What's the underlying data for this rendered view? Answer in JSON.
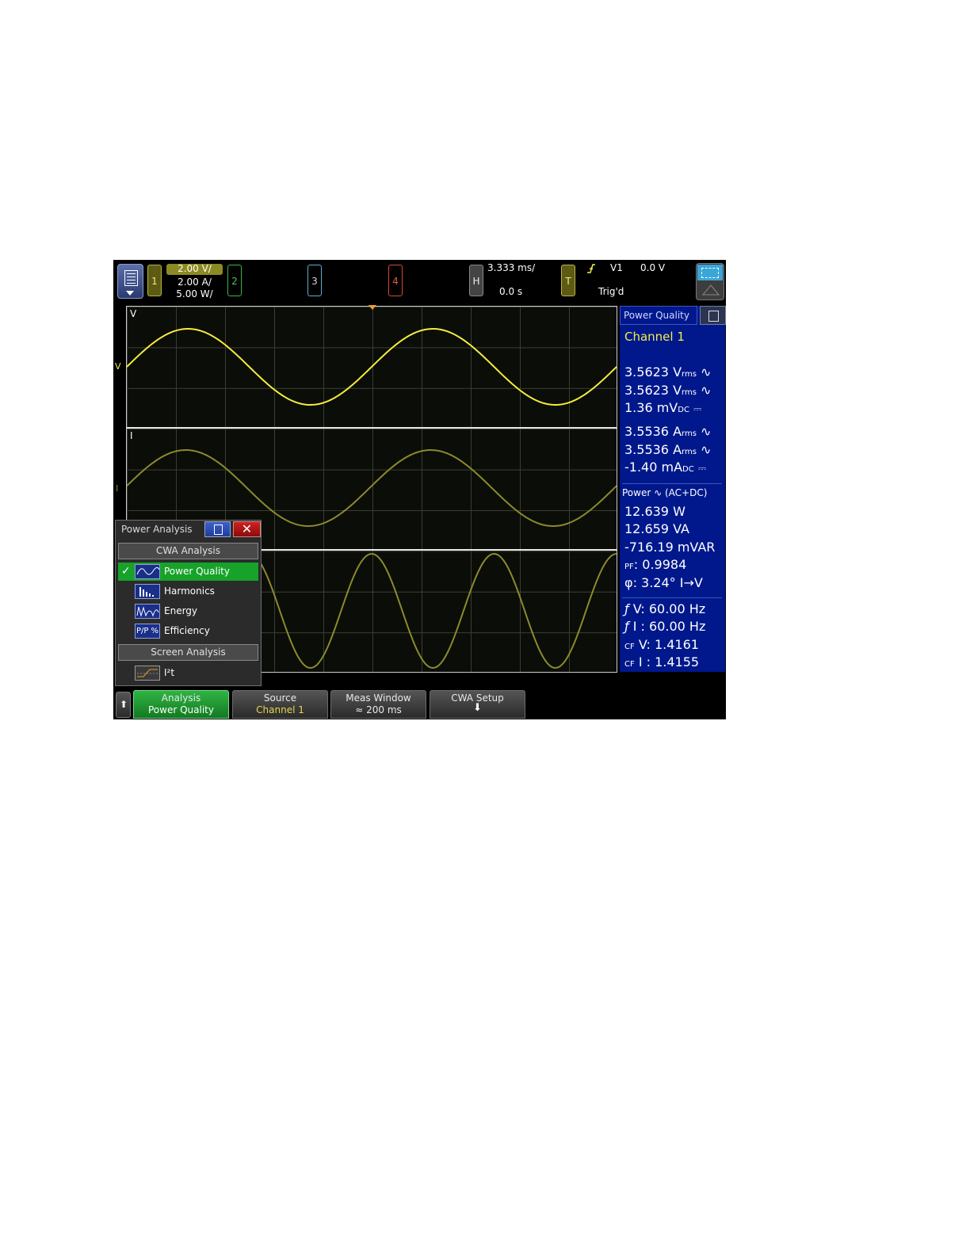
{
  "topbar": {
    "ch1_label": "1",
    "ch1_scales": [
      "2.00 V/",
      "2.00 A/",
      "5.00 W/"
    ],
    "ch2_label": "2",
    "ch3_label": "3",
    "ch4_label": "4",
    "horizontal_label": "H",
    "time_per_div": "3.333 ms/",
    "delay": "0.0 s",
    "trigger_label": "T",
    "trigger_source": "V1",
    "trigger_level": "0.0 V",
    "trigger_status": "Trig'd"
  },
  "graticule": {
    "label_v": "V",
    "label_i": "I",
    "marker_v": "V",
    "marker_i": "I"
  },
  "measurements": {
    "header": "Power Quality",
    "source": "Channel 1",
    "voltage": [
      {
        "value": "3.5623 V",
        "unit": "rms"
      },
      {
        "value": "3.5623 V",
        "unit": "rms"
      },
      {
        "value": "1.36 mV",
        "unit": "DC"
      }
    ],
    "current": [
      {
        "value": "3.5536 A",
        "unit": "rms"
      },
      {
        "value": "3.5536 A",
        "unit": "rms"
      },
      {
        "value": "-1.40 mA",
        "unit": "DC"
      }
    ],
    "power_header": "Power",
    "power_mode": "(AC+DC)",
    "power": [
      "12.639 W",
      "12.659 VA",
      "-716.19 mVAR"
    ],
    "pf_label": "PF",
    "pf_value": ": 0.9984",
    "phase_label": "φ",
    "phase_value": ": 3.24° I→V",
    "freq_v": "V: 60.00 Hz",
    "freq_i": "I : 60.00 Hz",
    "cf_label": "CF",
    "cf_v": "V: 1.4161",
    "cf_i": "I : 1.4155"
  },
  "popup": {
    "title": "Power Analysis",
    "section1": "CWA Analysis",
    "items": [
      {
        "label": "Power Quality",
        "selected": true
      },
      {
        "label": "Harmonics",
        "selected": false
      },
      {
        "label": "Energy",
        "selected": false
      },
      {
        "label": "Efficiency",
        "selected": false
      }
    ],
    "section2": "Screen Analysis",
    "screen_item": "I²t"
  },
  "softkeys": [
    {
      "line1": "Analysis",
      "line2": "Power Quality"
    },
    {
      "line1": "Source",
      "line2": "Channel 1"
    },
    {
      "line1": "Meas Window",
      "line2": "≈ 200 ms"
    },
    {
      "line1": "CWA Setup",
      "line2": ""
    }
  ],
  "colors": {
    "trace_v": "#f4ec3c",
    "trace_i": "#8c8a2c",
    "panel_blue": "#00188c",
    "selected_green": "#17a22a"
  },
  "waveforms": {
    "cycles_on_screen": 2,
    "v_phase_deg": 0,
    "i_phase_deg": 3.24
  }
}
